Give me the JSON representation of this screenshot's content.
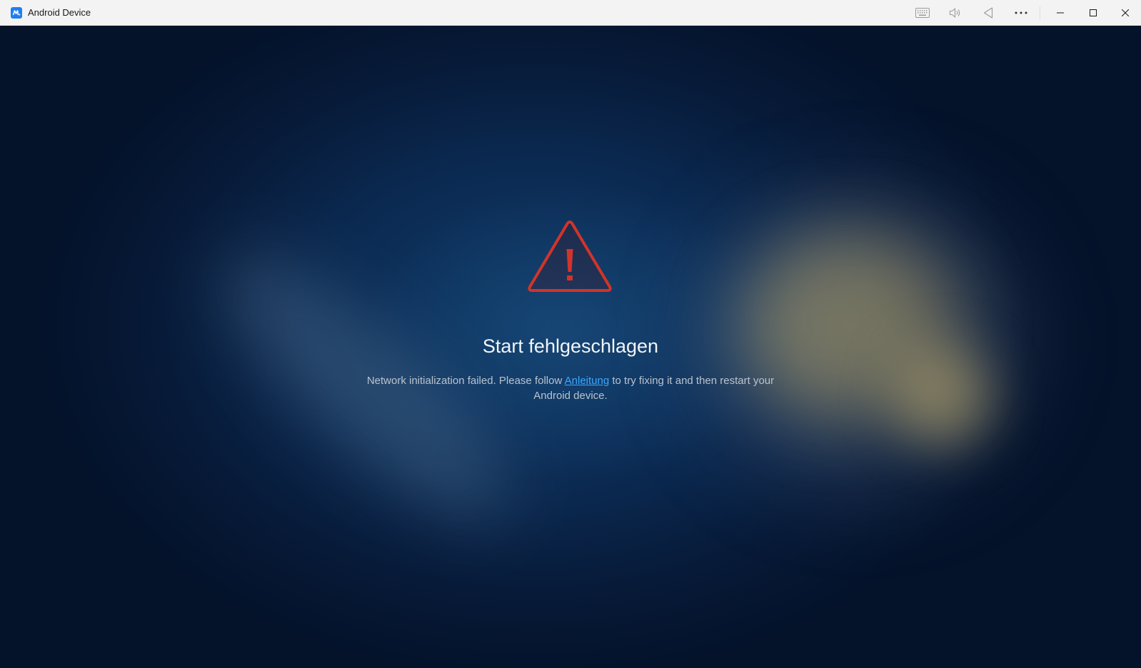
{
  "window": {
    "title": "Android Device"
  },
  "toolbar": {
    "icons": [
      "keyboard-icon",
      "volume-icon",
      "back-icon",
      "more-icon"
    ],
    "window_controls": [
      "minimize-icon",
      "maximize-icon",
      "close-icon"
    ]
  },
  "error": {
    "icon": "warning-triangle-icon",
    "icon_color": "#d2342a",
    "title": "Start fehlgeschlagen",
    "message_before": "Network initialization failed. Please follow ",
    "link_text": "Anleitung",
    "link_color": "#3aa8ff",
    "message_after": " to try fixing it and then restart your Android device."
  },
  "colors": {
    "app_icon": "#1e7ff0",
    "background": "#0a1d3a"
  }
}
